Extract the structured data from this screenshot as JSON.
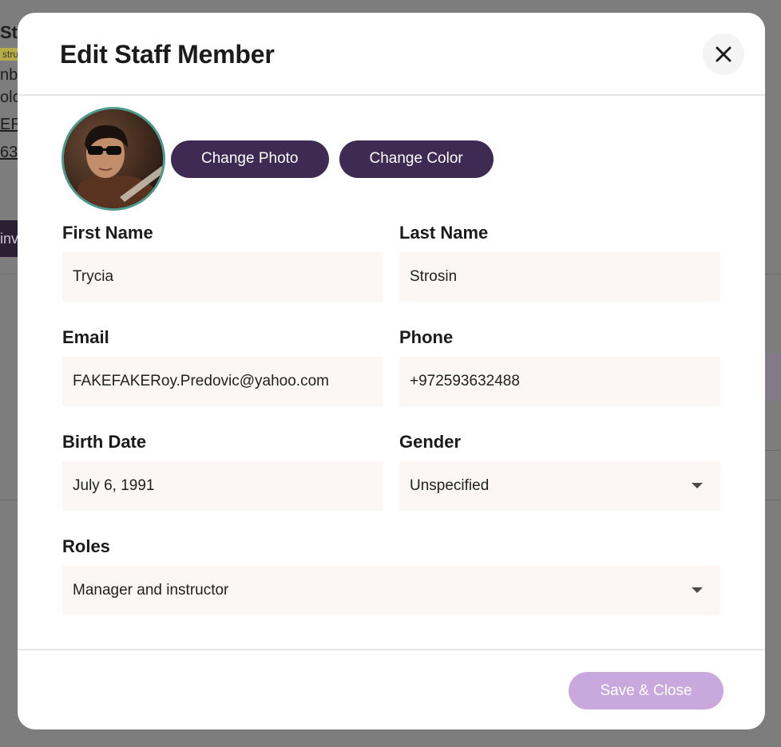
{
  "background": {
    "title": "Str",
    "badge": "stru",
    "line1": "nbe",
    "line2": "olc",
    "link1": "ERc",
    "link2": "63",
    "button": "inv"
  },
  "modal": {
    "title": "Edit Staff Member",
    "close_icon": "close-icon",
    "change_photo_label": "Change Photo",
    "change_color_label": "Change Color",
    "fields": {
      "first_name": {
        "label": "First Name",
        "value": "Trycia"
      },
      "last_name": {
        "label": "Last Name",
        "value": "Strosin"
      },
      "email": {
        "label": "Email",
        "value": "FAKEFAKERoy.Predovic@yahoo.com"
      },
      "phone": {
        "label": "Phone",
        "value": "+972593632488"
      },
      "birth_date": {
        "label": "Birth Date",
        "value": "July 6, 1991"
      },
      "gender": {
        "label": "Gender",
        "value": "Unspecified"
      },
      "roles": {
        "label": "Roles",
        "value": "Manager and instructor"
      }
    },
    "save_label": "Save & Close"
  },
  "colors": {
    "primary": "#3e2a52",
    "save_disabled": "#c9a8dd",
    "avatar_ring": "#4f9a8e",
    "field_bg": "#fcf7f5"
  }
}
